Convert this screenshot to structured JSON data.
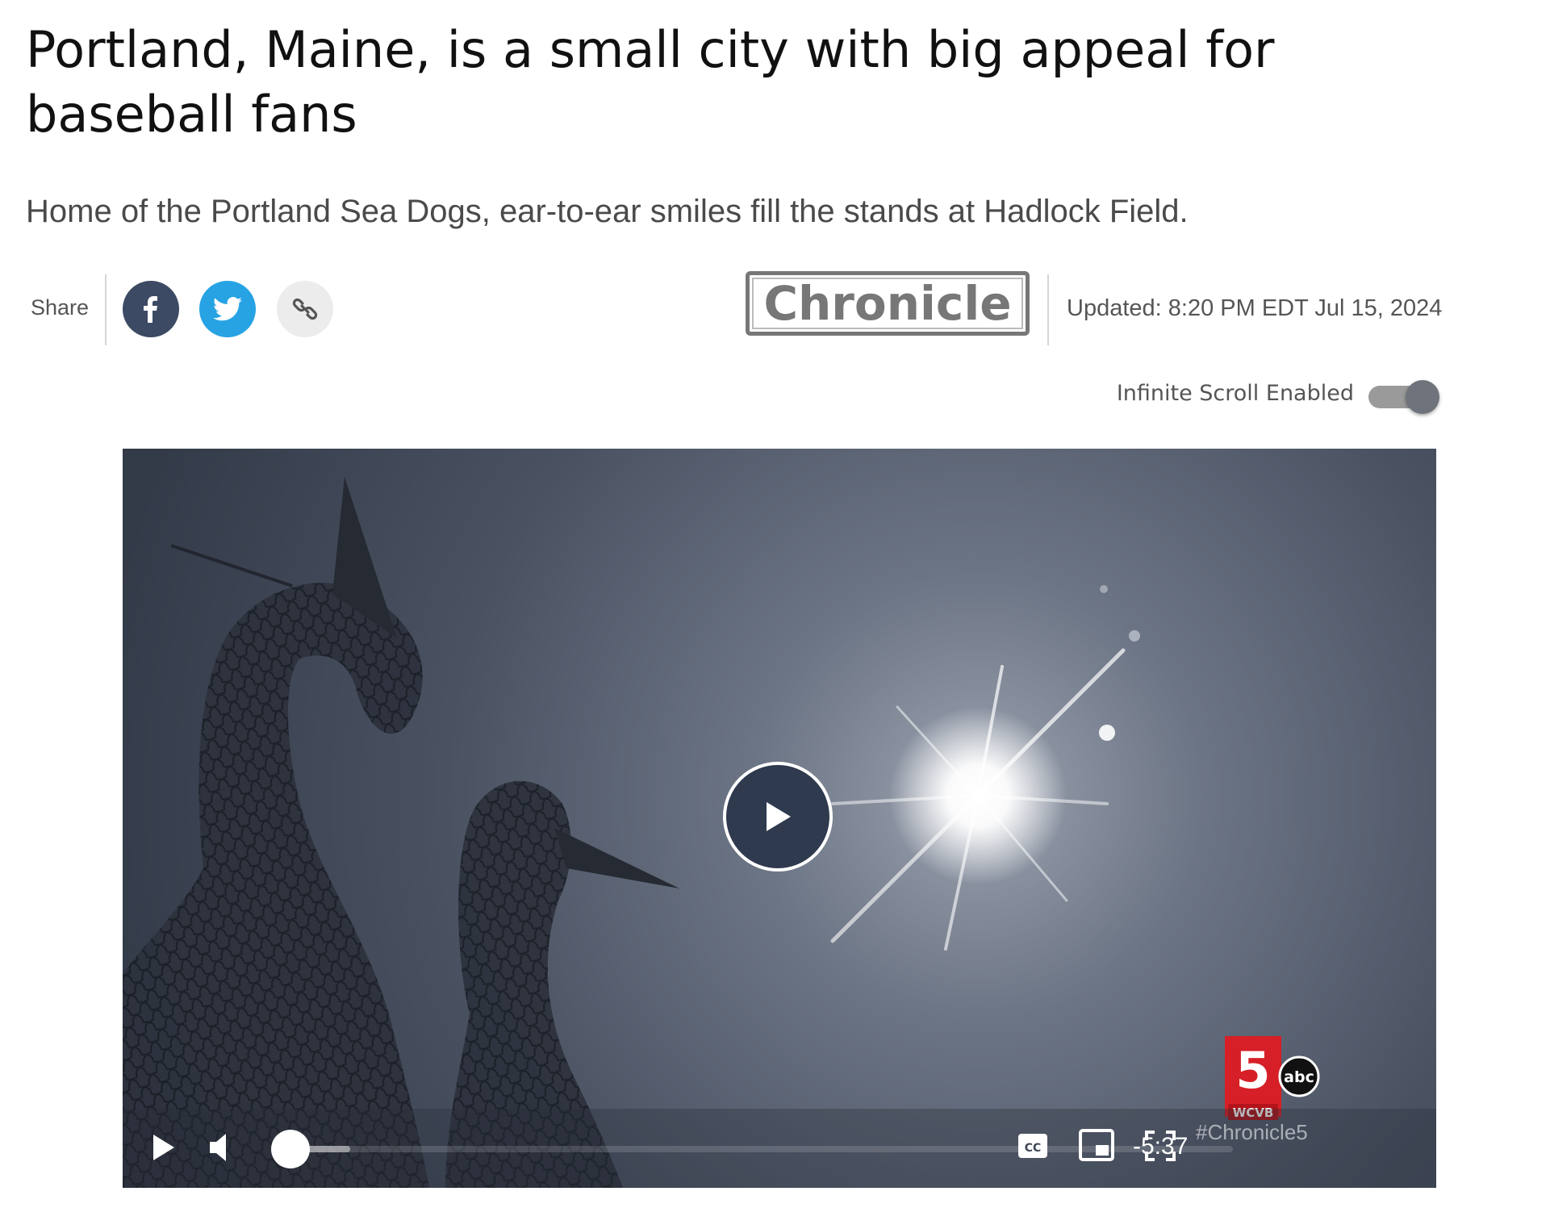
{
  "article": {
    "headline": "Portland, Maine, is a small city with big appeal for baseball fans",
    "dek": "Home of the Portland Sea Dogs, ear-to-ear smiles fill the stands at Hadlock Field."
  },
  "share": {
    "label": "Share",
    "buttons": [
      {
        "name": "facebook",
        "icon": "facebook-icon",
        "color": "#3c4a63"
      },
      {
        "name": "twitter",
        "icon": "twitter-icon",
        "color": "#27a3e3"
      },
      {
        "name": "copy-link",
        "icon": "link-icon",
        "color": "#ececec"
      }
    ]
  },
  "brand": {
    "logo_text": "Chronicle"
  },
  "updated": "Updated: 8:20 PM EDT Jul 15, 2024",
  "infinite_scroll": {
    "label": "Infinite Scroll Enabled",
    "enabled": true
  },
  "video": {
    "time_remaining": "-5:37",
    "hashtag": "#Chronicle5",
    "station": {
      "number": "5",
      "network": "abc",
      "call_sign": "WCVB"
    },
    "progress_fraction": 0.0,
    "buffered_fraction": 0.07,
    "controls": [
      "play-icon",
      "volume-icon",
      "closed-captions-icon",
      "picture-in-picture-icon",
      "fullscreen-icon"
    ]
  }
}
